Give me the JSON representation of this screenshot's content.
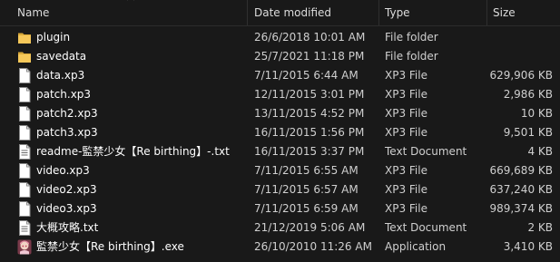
{
  "columns": {
    "name": "Name",
    "date": "Date modified",
    "type": "Type",
    "size": "Size"
  },
  "files": [
    {
      "icon": "folder-icon",
      "name": "plugin",
      "date": "26/6/2018 10:01 AM",
      "type": "File folder",
      "size": ""
    },
    {
      "icon": "folder-icon",
      "name": "savedata",
      "date": "25/7/2021 11:18 PM",
      "type": "File folder",
      "size": ""
    },
    {
      "icon": "file-icon",
      "name": "data.xp3",
      "date": "7/11/2015 6:44 AM",
      "type": "XP3 File",
      "size": "629,906 KB"
    },
    {
      "icon": "file-icon",
      "name": "patch.xp3",
      "date": "12/11/2015 3:01 PM",
      "type": "XP3 File",
      "size": "2,986 KB"
    },
    {
      "icon": "file-icon",
      "name": "patch2.xp3",
      "date": "13/11/2015 4:52 PM",
      "type": "XP3 File",
      "size": "10 KB"
    },
    {
      "icon": "file-icon",
      "name": "patch3.xp3",
      "date": "16/11/2015 1:56 PM",
      "type": "XP3 File",
      "size": "9,501 KB"
    },
    {
      "icon": "text-document-icon",
      "name": "readme-監禁少女【Re birthing】-.txt",
      "date": "16/11/2015 3:37 PM",
      "type": "Text Document",
      "size": "4 KB"
    },
    {
      "icon": "file-icon",
      "name": "video.xp3",
      "date": "7/11/2015 6:55 AM",
      "type": "XP3 File",
      "size": "669,689 KB"
    },
    {
      "icon": "file-icon",
      "name": "video2.xp3",
      "date": "7/11/2015 6:57 AM",
      "type": "XP3 File",
      "size": "637,240 KB"
    },
    {
      "icon": "file-icon",
      "name": "video3.xp3",
      "date": "7/11/2015 6:59 AM",
      "type": "XP3 File",
      "size": "989,374 KB"
    },
    {
      "icon": "text-document-icon",
      "name": "大概攻略.txt",
      "date": "21/12/2019 5:06 AM",
      "type": "Text Document",
      "size": "2 KB"
    },
    {
      "icon": "application-icon",
      "name": "監禁少女【Re birthing】.exe",
      "date": "26/10/2010 11:26 AM",
      "type": "Application",
      "size": "3,410 KB"
    }
  ]
}
